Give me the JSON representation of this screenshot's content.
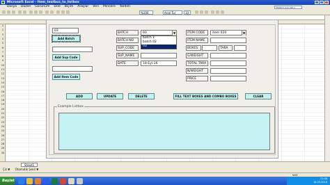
{
  "excel": {
    "title": "Microsoft Excel - Item_textbox_to_listbox",
    "menu": [
      "Dosya",
      "Düzen",
      "Görünüm",
      "Ekle",
      "Biçim",
      "Araçlar",
      "Veri",
      "Pencere",
      "Yardım"
    ],
    "help_placeholder": "Yardım için soru yazın",
    "zoom": "%100",
    "font_name": "Arial Tur",
    "font_size": "10",
    "sheet_tab": "Sheet1",
    "draw_label": "Çiz ▼",
    "autoshapes_label": "Otomatik Şekil ▼",
    "status_caps": "SAYI",
    "row_numbers": [
      "1",
      "2",
      "3",
      "4",
      "5",
      "6",
      "7",
      "8",
      "9",
      "10",
      "11",
      "12",
      "13",
      "14",
      "15",
      "16",
      "17",
      "18",
      "19",
      "20",
      "21",
      "22",
      "23",
      "24",
      "25",
      "26",
      "27",
      "28",
      "29",
      "30"
    ],
    "start_label": "Başlat",
    "clock_time": "21:08",
    "clock_date": "16.09.2016"
  },
  "form": {
    "batch_input_value": "03",
    "add_batch_label": "Add Batch",
    "add_sup_code_label": "Add Sup Code",
    "add_item_code_label": "Add Item Code",
    "labels": {
      "batch": "BATCH",
      "batch_no": "BATCH NO",
      "sup_code": "SUP_CODE",
      "sup_name": "SUP_NAME",
      "date": "DATE",
      "item_code": "ITEM CODE",
      "item_name": "ITEM NAME",
      "boxes": "BOXES",
      "tara": "TARA",
      "gweight": "G/WEIGHT",
      "total_tara": "TOTAL TARA",
      "nweight": "N/WEIGHT",
      "price": "PRICE"
    },
    "batch_combo_value": "03",
    "batch_options": [
      "batch 1",
      "batch 02",
      "03"
    ],
    "batch_selected": "03",
    "date_value": "18-Eyl-16",
    "item_code_value": "item 020",
    "buttons": {
      "add": "ADD",
      "update": "UPDATE",
      "delete": "DELETE",
      "fill": "FILL TEXT BOXES AND COMBO BOXES",
      "clear": "CLEAR"
    },
    "listbox_caption": "Example Listbox"
  }
}
